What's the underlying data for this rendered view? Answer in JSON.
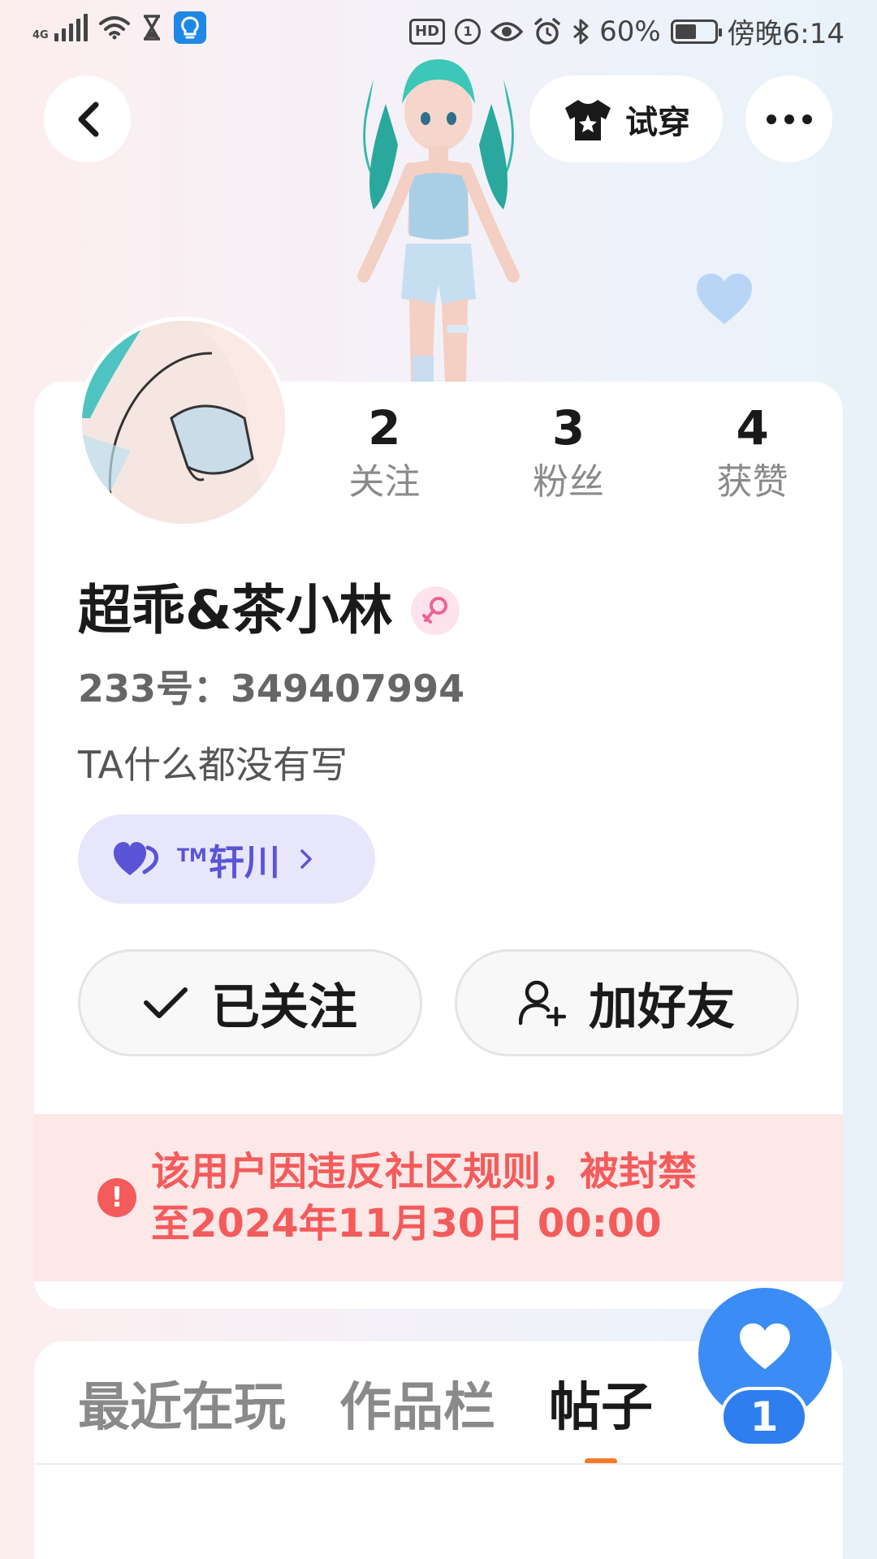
{
  "status_bar": {
    "network": "4G",
    "hd_label": "HD",
    "sim_label": "1",
    "battery": "60%",
    "time": "傍晚6:14"
  },
  "header": {
    "try_on_label": "试穿"
  },
  "profile": {
    "stats": [
      {
        "value": "2",
        "label": "关注"
      },
      {
        "value": "3",
        "label": "粉丝"
      },
      {
        "value": "4",
        "label": "获赞"
      }
    ],
    "name": "超乖&茶小林",
    "gender": "female",
    "uid": "233号：349407994",
    "bio": "TA什么都没有写",
    "cp": {
      "tm": "TM",
      "name": "轩川"
    },
    "follow_label": "已关注",
    "add_friend_label": "加好友",
    "ban_notice_line1": "该用户因违反社区规则，被封禁",
    "ban_notice_line2": "至2024年11月30日 00:00"
  },
  "tabs": [
    {
      "label": "最近在玩",
      "active": false
    },
    {
      "label": "作品栏",
      "active": false
    },
    {
      "label": "帖子",
      "active": true
    }
  ],
  "fab": {
    "like_count": "1"
  },
  "colors": {
    "accent_blue": "#3b8cf5",
    "ban_red": "#f45b5b",
    "cp_purple": "#5b54d6",
    "tab_indicator": "#f5792a"
  }
}
